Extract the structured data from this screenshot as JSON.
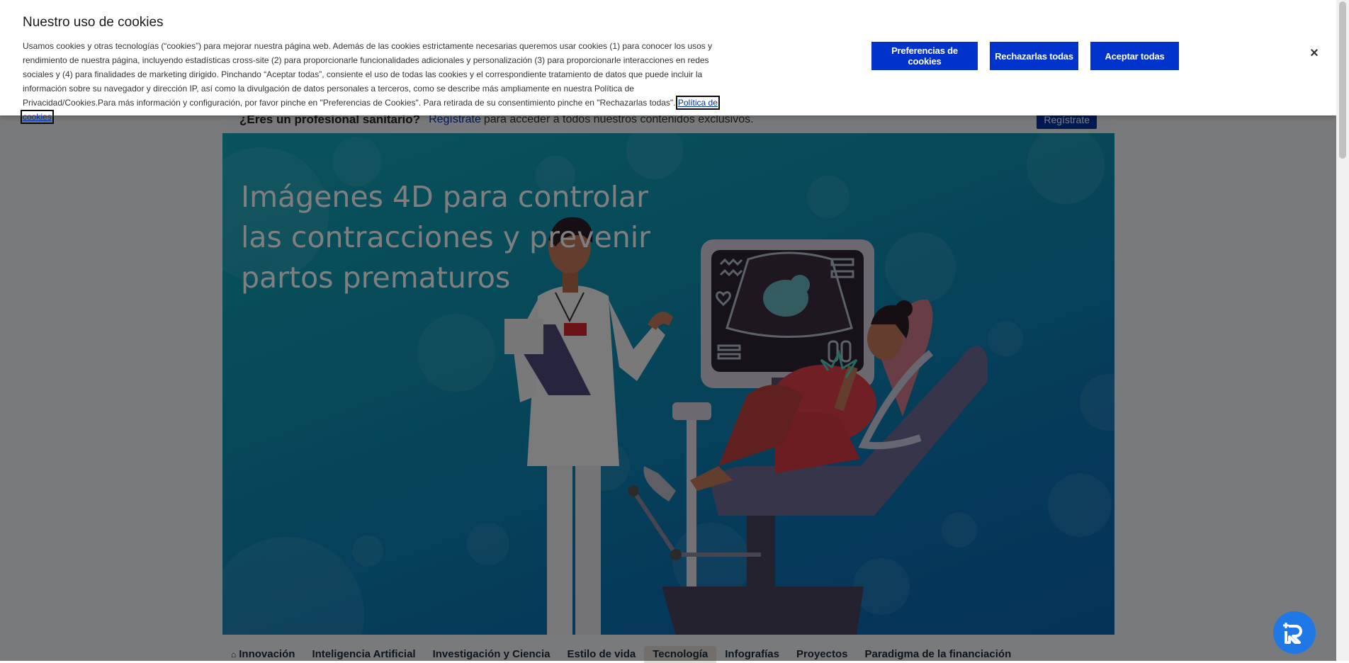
{
  "cookie_banner": {
    "title": "Nuestro uso de cookies",
    "body": "Usamos cookies y otras tecnologías (“cookies”) para mejorar nuestra página web. Además de las cookies estrictamente necesarias queremos usar cookies (1) para conocer los usos y rendimiento de nuestra página, incluyendo estadísticas cross-site (2) para proporcionarle funcionalidades adicionales y personalización (3) para proporcionarle interacciones en redes sociales y (4) para finalidades de marketing dirigido. Pinchando “Aceptar todas”, consiente el uso de todas las cookies y el correspondiente tratamiento de datos que puede incluir la información sobre su navegador y dirección IP, así como la divulgación de datos personales a terceros, como se describe más ampliamente en nuestra Política de Privacidad/Cookies.Para más información y configuración, por favor pinche en \"Preferencias de Cookies\". Para retirada de su consentimiento pinche en \"Rechazarlas todas\".",
    "policy_link": "Política de cookies",
    "preferences_button": "Preferencias de cookies",
    "reject_button": "Rechazarlas todas",
    "accept_button": "Aceptar todas",
    "close_icon": "×"
  },
  "pro_banner": {
    "question": "¿Eres un profesional sanitario?",
    "link": "Regístrate",
    "rest": "para acceder a todos nuestros contenidos exclusivos.",
    "button": "Regístrate"
  },
  "hero": {
    "title": "Imágenes 4D para controlar las contracciones y prevenir partos prematuros"
  },
  "subnav": {
    "items": [
      {
        "label": "Innovación",
        "icon": "home-icon"
      },
      {
        "label": "Inteligencia Artificial"
      },
      {
        "label": "Investigación y Ciencia"
      },
      {
        "label": "Estilo de vida"
      },
      {
        "label": "Tecnología",
        "active": true
      },
      {
        "label": "Infografías"
      },
      {
        "label": "Proyectos"
      },
      {
        "label": "Paradigma de la financiación"
      }
    ]
  },
  "colors": {
    "accent_button": "#0033cc",
    "overlay": "rgba(0,0,0,0.5)",
    "chat_fab": "#1e78e6"
  }
}
